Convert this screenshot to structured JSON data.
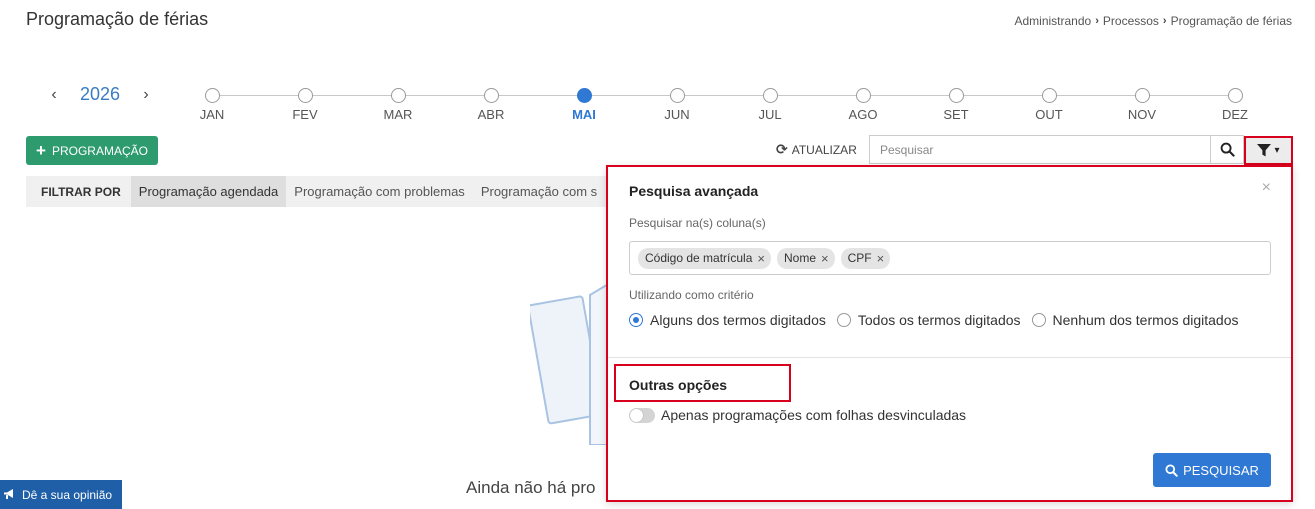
{
  "page": {
    "title": "Programação de férias"
  },
  "breadcrumb": [
    "Administrando",
    "Processos",
    "Programação de férias"
  ],
  "year_nav": {
    "prev": "‹",
    "year": "2026",
    "next": "›"
  },
  "timeline": {
    "months": [
      "JAN",
      "FEV",
      "MAR",
      "ABR",
      "MAI",
      "JUN",
      "JUL",
      "AGO",
      "SET",
      "OUT",
      "NOV",
      "DEZ"
    ],
    "active": "MAI"
  },
  "toolbar": {
    "add_label": "PROGRAMAÇÃO",
    "refresh_label": "ATUALIZAR",
    "search_placeholder": "Pesquisar"
  },
  "filter_bar": {
    "label": "FILTRAR POR",
    "chips": [
      "Programação agendada",
      "Programação com problemas",
      "Programação com s"
    ]
  },
  "empty_message": "Ainda não há pro",
  "feedback_label": "Dê a sua opinião",
  "advanced_search": {
    "title": "Pesquisa avançada",
    "close": "×",
    "columns_label": "Pesquisar na(s) coluna(s)",
    "tags": [
      "Código de matrícula",
      "Nome",
      "CPF"
    ],
    "criteria_label": "Utilizando como critério",
    "radios": [
      "Alguns dos termos digitados",
      "Todos os termos digitados",
      "Nenhum dos termos digitados"
    ],
    "other_title": "Outras opções",
    "toggle_label": "Apenas programações com folhas desvinculadas",
    "search_button": "PESQUISAR"
  },
  "colors": {
    "accent": "#2f78d4",
    "green": "#2e9b6e",
    "highlight": "#d8001c"
  }
}
